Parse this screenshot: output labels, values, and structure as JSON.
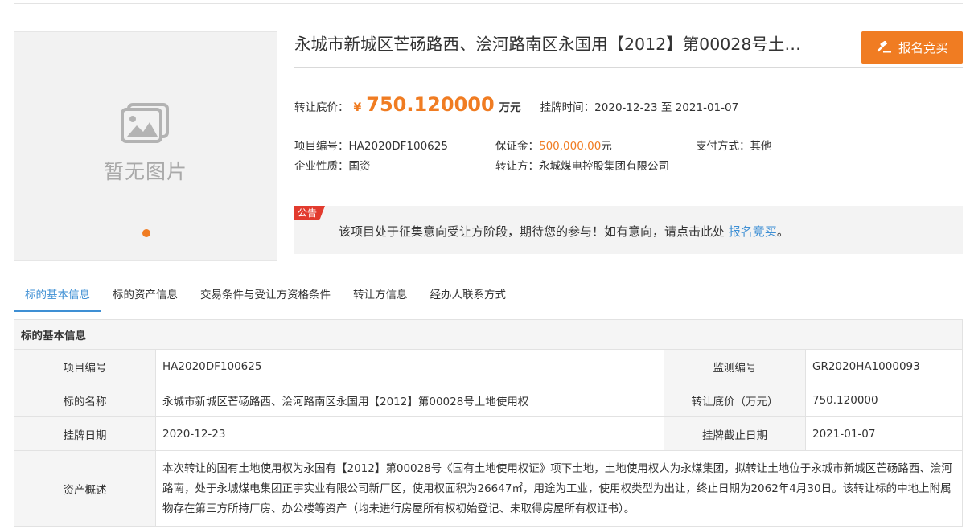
{
  "image_panel": {
    "placeholder_text": "暂无图片"
  },
  "header": {
    "title": "永城市新城区芒砀路西、浍河路南区永国用【2012】第00028号土…",
    "signup_label": "报名竞买"
  },
  "price": {
    "label": "转让底价：",
    "currency": "¥",
    "value": "750.120000",
    "unit": "万元",
    "time_label": "挂牌时间：",
    "time_value": "2020-12-23 至 2021-01-07"
  },
  "meta": {
    "project_no_label": "项目编号：",
    "project_no": "HA2020DF100625",
    "deposit_label": "保证金：",
    "deposit_value": "500,000.00",
    "deposit_unit": "元",
    "payment_label": "支付方式：",
    "payment_value": "其他",
    "enterprise_label": "企业性质：",
    "enterprise_value": "国资",
    "transferor_label": "转让方：",
    "transferor_value": "永城煤电控股集团有限公司"
  },
  "notice": {
    "tag": "公告",
    "text": "该项目处于征集意向受让方阶段，期待您的参与！如有意向，请点击此处",
    "link": "报名竞买",
    "end": "。"
  },
  "tabs": [
    "标的基本信息",
    "标的资产信息",
    "交易条件与受让方资格条件",
    "转让方信息",
    "经办人联系方式"
  ],
  "table": {
    "heading": "标的基本信息",
    "rows": [
      {
        "k1": "项目编号",
        "v1": "HA2020DF100625",
        "k2": "监测编号",
        "v2": "GR2020HA1000093"
      },
      {
        "k1": "标的名称",
        "v1": "永城市新城区芒砀路西、浍河路南区永国用【2012】第00028号土地使用权",
        "k2": "转让底价（万元）",
        "v2": "750.120000"
      },
      {
        "k1": "挂牌日期",
        "v1": "2020-12-23",
        "k2": "挂牌截止日期",
        "v2": "2021-01-07"
      }
    ],
    "desc_label": "资产概述",
    "desc_text": "本次转让的国有土地使用权为永国有【2012】第00028号《国有土地使用权证》项下土地，土地使用权人为永煤集团，拟转让土地位于永城市新城区芒砀路西、浍河路南，处于永城煤电集团正宇实业有限公司新厂区，使用权面积为26647㎡，用途为工业，使用权类型为出让，终止日期为2062年4月30日。该转让标的中地上附属物存在第三方所持厂房、办公楼等资产（均未进行房屋所有权初始登记、未取得房屋所有权证书）。"
  },
  "colors": {
    "accent": "#f07c22",
    "link": "#3e8fd4",
    "tag": "#e23b2e"
  }
}
